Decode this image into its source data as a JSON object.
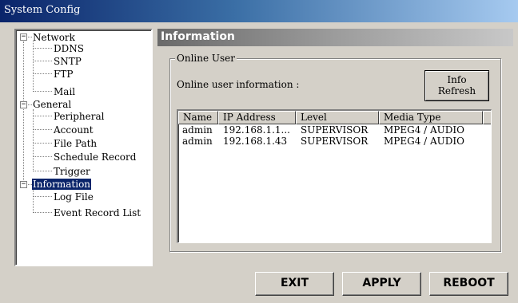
{
  "window": {
    "title": "System Config"
  },
  "tree": {
    "groups": [
      {
        "label": "Network",
        "expander": "−",
        "children": [
          "DDNS",
          "SNTP",
          "FTP",
          "Mail"
        ]
      },
      {
        "label": "General",
        "expander": "−",
        "children": [
          "Peripheral",
          "Account",
          "File Path",
          "Schedule Record",
          "Trigger"
        ]
      },
      {
        "label": "Information",
        "expander": "−",
        "selected": true,
        "children": [
          "Log File",
          "Event Record List"
        ]
      }
    ]
  },
  "panel": {
    "title": "Information"
  },
  "online_user": {
    "legend": "Online User",
    "info_label": "Online user information :",
    "refresh_button": {
      "line1": "Info",
      "line2": "Refresh"
    },
    "columns": [
      "Name",
      "IP Address",
      "Level",
      "Media Type"
    ],
    "rows": [
      [
        "admin",
        "192.168.1.1...",
        "SUPERVISOR",
        "MPEG4 / AUDIO"
      ],
      [
        "admin",
        "192.168.1.43",
        "SUPERVISOR",
        "MPEG4 / AUDIO"
      ]
    ]
  },
  "footer": {
    "exit_label": "EXIT",
    "apply_label": "APPLY",
    "reboot_label": "REBOOT"
  },
  "colors": {
    "selection": "#0a246a",
    "face": "#d4d0c8",
    "title_start": "#0a246a",
    "title_end": "#a6caf0"
  },
  "icons": {
    "expander": "minus-box-icon"
  }
}
